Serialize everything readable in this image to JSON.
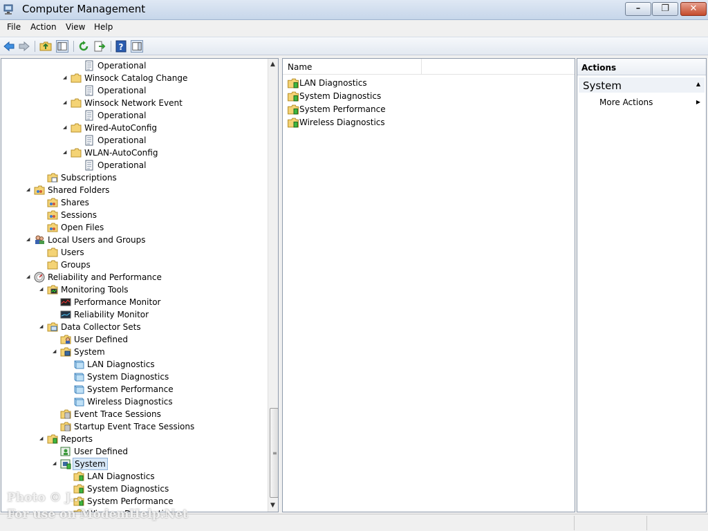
{
  "window": {
    "title": "Computer Management",
    "minimize": "–",
    "maximize": "❐",
    "close": "✕"
  },
  "menu": [
    "File",
    "Action",
    "View",
    "Help"
  ],
  "tree": {
    "items": [
      {
        "label": "Operational",
        "icon": "log-icon",
        "indent": 3,
        "expander": ""
      },
      {
        "label": "Winsock Catalog Change",
        "icon": "folder-icon",
        "indent": 2,
        "expander": "◢"
      },
      {
        "label": "Operational",
        "icon": "log-icon",
        "indent": 3,
        "expander": ""
      },
      {
        "label": "Winsock Network Event",
        "icon": "folder-icon",
        "indent": 2,
        "expander": "◢"
      },
      {
        "label": "Operational",
        "icon": "log-icon",
        "indent": 3,
        "expander": ""
      },
      {
        "label": "Wired-AutoConfig",
        "icon": "folder-icon",
        "indent": 2,
        "expander": "◢"
      },
      {
        "label": "Operational",
        "icon": "log-icon",
        "indent": 3,
        "expander": ""
      },
      {
        "label": "WLAN-AutoConfig",
        "icon": "folder-icon",
        "indent": 2,
        "expander": "◢"
      },
      {
        "label": "Operational",
        "icon": "log-icon",
        "indent": 3,
        "expander": ""
      },
      {
        "label": "Subscriptions",
        "icon": "subscriptions-icon",
        "indent": 0.2,
        "expander": ""
      },
      {
        "label": "Shared Folders",
        "icon": "shared-folder-icon",
        "indent": -0.8,
        "expander": "◢"
      },
      {
        "label": "Shares",
        "icon": "shared-folder-icon",
        "indent": 0.2,
        "expander": ""
      },
      {
        "label": "Sessions",
        "icon": "shared-folder-icon",
        "indent": 0.2,
        "expander": ""
      },
      {
        "label": "Open Files",
        "icon": "shared-folder-icon",
        "indent": 0.2,
        "expander": ""
      },
      {
        "label": "Local Users and Groups",
        "icon": "users-icon",
        "indent": -0.8,
        "expander": "◢"
      },
      {
        "label": "Users",
        "icon": "folder-icon",
        "indent": 0.2,
        "expander": ""
      },
      {
        "label": "Groups",
        "icon": "folder-icon",
        "indent": 0.2,
        "expander": ""
      },
      {
        "label": "Reliability and Performance",
        "icon": "gauge-icon",
        "indent": -0.8,
        "expander": "◢"
      },
      {
        "label": "Monitoring Tools",
        "icon": "monitor-folder-icon",
        "indent": 0.2,
        "expander": "◢"
      },
      {
        "label": "Performance Monitor",
        "icon": "perfmon-icon",
        "indent": 1.2,
        "expander": ""
      },
      {
        "label": "Reliability Monitor",
        "icon": "relmon-icon",
        "indent": 1.2,
        "expander": ""
      },
      {
        "label": "Data Collector Sets",
        "icon": "dcs-folder-icon",
        "indent": 0.2,
        "expander": "◢"
      },
      {
        "label": "User Defined",
        "icon": "user-folder-icon",
        "indent": 1.2,
        "expander": ""
      },
      {
        "label": "System",
        "icon": "system-folder-icon",
        "indent": 1.2,
        "expander": "◢"
      },
      {
        "label": "LAN Diagnostics",
        "icon": "collector-set-icon",
        "indent": 2.2,
        "expander": ""
      },
      {
        "label": "System Diagnostics",
        "icon": "collector-set-icon",
        "indent": 2.2,
        "expander": ""
      },
      {
        "label": "System Performance",
        "icon": "collector-set-icon",
        "indent": 2.2,
        "expander": ""
      },
      {
        "label": "Wireless Diagnostics",
        "icon": "collector-set-icon",
        "indent": 2.2,
        "expander": ""
      },
      {
        "label": "Event Trace Sessions",
        "icon": "trace-folder-icon",
        "indent": 1.2,
        "expander": ""
      },
      {
        "label": "Startup Event Trace Sessions",
        "icon": "trace-folder-icon",
        "indent": 1.2,
        "expander": ""
      },
      {
        "label": "Reports",
        "icon": "report-folder-icon",
        "indent": 0.2,
        "expander": "◢"
      },
      {
        "label": "User Defined",
        "icon": "report-user-icon",
        "indent": 1.2,
        "expander": ""
      },
      {
        "label": "System",
        "icon": "report-system-icon",
        "indent": 1.2,
        "expander": "◢",
        "selected": true
      },
      {
        "label": "LAN Diagnostics",
        "icon": "report-icon",
        "indent": 2.2,
        "expander": ""
      },
      {
        "label": "System Diagnostics",
        "icon": "report-icon",
        "indent": 2.2,
        "expander": ""
      },
      {
        "label": "System Performance",
        "icon": "report-icon",
        "indent": 2.2,
        "expander": ""
      },
      {
        "label": "Wireless Diagnostics",
        "icon": "report-icon",
        "indent": 2.2,
        "expander": ""
      }
    ]
  },
  "list": {
    "columns": [
      "Name"
    ],
    "rows": [
      "LAN Diagnostics",
      "System Diagnostics",
      "System Performance",
      "Wireless Diagnostics"
    ]
  },
  "actions": {
    "title": "Actions",
    "section": "System",
    "items": [
      "More Actions"
    ]
  },
  "watermark": [
    "Photo © J...",
    "For use on ModemHelp.Net"
  ]
}
